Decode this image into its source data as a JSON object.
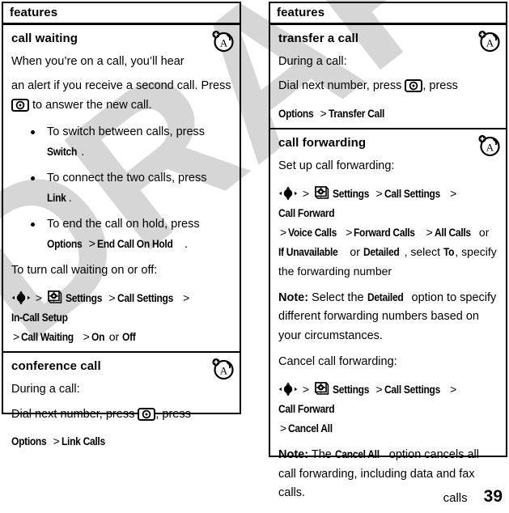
{
  "document": {
    "watermark": "DRAFT",
    "footer": {
      "chapter": "calls",
      "page_number": "39"
    }
  },
  "left_column": {
    "header": "features",
    "sections": [
      {
        "title": "call waiting",
        "badge_icon": "network-operator-icon",
        "p1": "When you’re on a call, you’ll hear",
        "p2_a": "an alert if you receive a second call. Press",
        "p2_b": "to answer the new call.",
        "bullets": [
          {
            "text_a": "To switch between calls, press",
            "key": "Switch",
            "text_b": "."
          },
          {
            "text_a": "To connect the two calls, press",
            "key": "Link",
            "text_b": "."
          },
          {
            "text_a": "To end the call on hold, press",
            "key": "Options",
            "sep": ">",
            "key2": "End Call On Hold",
            "text_b": "."
          }
        ],
        "p3": "To turn call waiting on or off:",
        "path": {
          "nav_icon": "navigation-key-icon",
          "gt1": ">",
          "settings_icon": "settings-gear-icon",
          "k1": "Settings",
          "gt2": ">",
          "k2": "Call Settings",
          "gt3": ">",
          "k3": "In-Call Setup",
          "gt4": ">",
          "k4": "Call Waiting",
          "gt5": ">",
          "k5": "On",
          "or": "or",
          "k6": "Off"
        }
      },
      {
        "title": "conference call",
        "badge_icon": "network-operator-icon",
        "p1": "During a call:",
        "p2_a": "Dial next number, press",
        "p2_b": ", press",
        "path": {
          "k1": "Options",
          "gt1": ">",
          "k2": "Link Calls"
        }
      }
    ]
  },
  "right_column": {
    "header": "features",
    "sections": [
      {
        "title": "transfer a call",
        "badge_icon": "network-operator-icon",
        "p1": "During a call:",
        "p2_a": "Dial next number, press",
        "p2_b": ", press",
        "path": {
          "k1": "Options",
          "gt1": ">",
          "k2": "Transfer Call"
        }
      },
      {
        "title": "call forwarding",
        "badge_icon": "network-operator-icon",
        "p1": "Set up call forwarding:",
        "path": {
          "nav_icon": "navigation-key-icon",
          "gt1": ">",
          "settings_icon": "settings-gear-icon",
          "k1": "Settings",
          "gt2": ">",
          "k2": "Call Settings",
          "gt3": ">",
          "k3": "Call Forward",
          "gt4": ">",
          "k4": "Voice Calls",
          "gt5": ">",
          "k5": "Forward Calls",
          "gt6": ">",
          "k6": "All Calls",
          "or1": "or",
          "k7": "If Unavailable",
          "or2": "or",
          "k8": "Detailed",
          "mid": ", select",
          "k9": "To",
          "tail": ", specify the forwarding number"
        },
        "note1_label": "Note:",
        "note1_a": "Select the",
        "note1_key": "Detailed",
        "note1_b": "option to specify different forwarding numbers based on your circumstances.",
        "p2": "Cancel call forwarding:",
        "path2": {
          "nav_icon": "navigation-key-icon",
          "gt1": ">",
          "settings_icon": "settings-gear-icon",
          "k1": "Settings",
          "gt2": ">",
          "k2": "Call Settings",
          "gt3": ">",
          "k3": "Call Forward",
          "gt4": ">",
          "k4": "Cancel All"
        },
        "note2_label": "Note:",
        "note2_a": "The",
        "note2_key": "Cancel All",
        "note2_b": "option cancels all call forwarding, including data and fax calls."
      }
    ]
  }
}
